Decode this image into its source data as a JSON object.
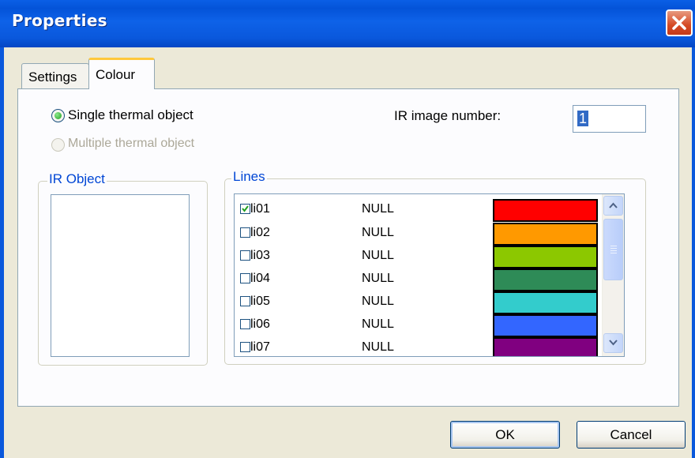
{
  "window": {
    "title": "Properties"
  },
  "tabs": [
    {
      "label": "Settings",
      "active": false
    },
    {
      "label": "Colour",
      "active": true
    }
  ],
  "mode": {
    "single_label": "Single thermal object",
    "single_selected": true,
    "multiple_label": "Multiple thermal object",
    "multiple_enabled": false
  },
  "ir_image": {
    "label": "IR image number:",
    "value": "1"
  },
  "ir_object": {
    "label": "IR Object",
    "items": []
  },
  "lines": {
    "label": "Lines",
    "rows": [
      {
        "name": "li01",
        "value": "NULL",
        "checked": true,
        "color": "#FF0000"
      },
      {
        "name": "li02",
        "value": "NULL",
        "checked": false,
        "color": "#FF9900"
      },
      {
        "name": "li03",
        "value": "NULL",
        "checked": false,
        "color": "#8CC800"
      },
      {
        "name": "li04",
        "value": "NULL",
        "checked": false,
        "color": "#2E8B57"
      },
      {
        "name": "li05",
        "value": "NULL",
        "checked": false,
        "color": "#33CCCC"
      },
      {
        "name": "li06",
        "value": "NULL",
        "checked": false,
        "color": "#3366FF"
      },
      {
        "name": "li07",
        "value": "NULL",
        "checked": false,
        "color": "#800080"
      }
    ]
  },
  "buttons": {
    "ok": "OK",
    "cancel": "Cancel"
  }
}
